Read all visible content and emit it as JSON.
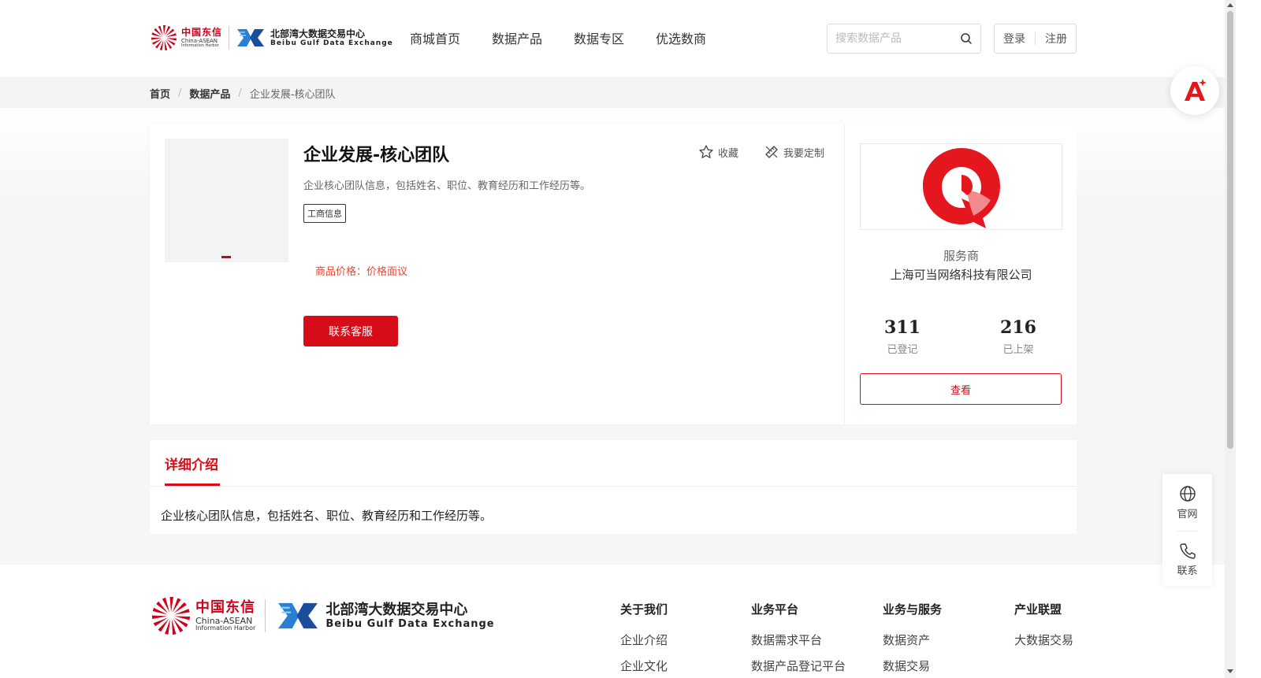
{
  "header": {
    "logo_cn_line1": "中国东信",
    "logo_cn_line2": "China-ASEAN",
    "logo_cn_line3": "Information Harbor",
    "logo_bx_line1": "北部湾大数据交易中心",
    "logo_bx_line2": "Beibu Gulf Data Exchange",
    "nav": [
      "商城首页",
      "数据产品",
      "数据专区",
      "优选数商"
    ],
    "search_placeholder": "搜索数据产品",
    "login": "登录",
    "register": "注册"
  },
  "breadcrumb": {
    "home": "首页",
    "category": "数据产品",
    "current": "企业发展-核心团队"
  },
  "product": {
    "title": "企业发展-核心团队",
    "favorite": "收藏",
    "customize": "我要定制",
    "description": "企业核心团队信息，包括姓名、职位、教育经历和工作经历等。",
    "tag": "工商信息",
    "price_label": "商品价格：",
    "price_value": "价格面议",
    "contact_button": "联系客服"
  },
  "provider": {
    "label": "服务商",
    "name": "上海可当网络科技有限公司",
    "stats": [
      {
        "value": "311",
        "label": "已登记"
      },
      {
        "value": "216",
        "label": "已上架"
      }
    ],
    "view_button": "查看"
  },
  "detail": {
    "tab": "详细介绍",
    "text": "企业核心团队信息，包括姓名、职位、教育经历和工作经历等。"
  },
  "footer": {
    "columns": [
      {
        "title": "关于我们",
        "items": [
          "企业介绍",
          "企业文化"
        ]
      },
      {
        "title": "业务平台",
        "items": [
          "数据需求平台",
          "数据产品登记平台"
        ]
      },
      {
        "title": "业务与服务",
        "items": [
          "数据资产",
          "数据交易"
        ]
      },
      {
        "title": "产业联盟",
        "items": [
          "大数据交易"
        ]
      }
    ]
  },
  "side": {
    "website": "官网",
    "contact": "联系"
  },
  "colors": {
    "brand_red": "#d70c18",
    "price_orange": "#e8452f"
  }
}
